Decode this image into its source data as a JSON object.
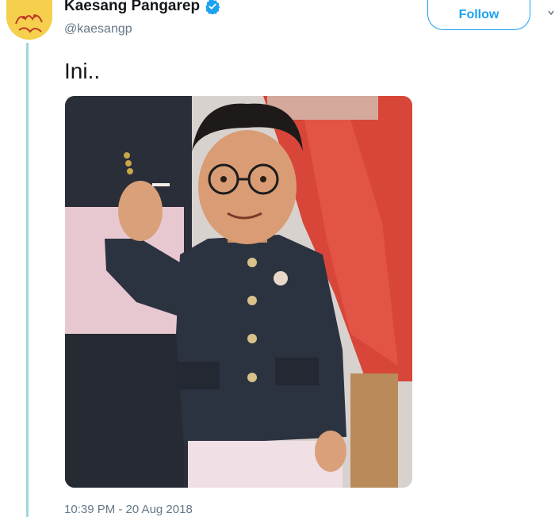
{
  "tweet": {
    "author_name": "Kaesang Pangarep",
    "author_handle": "@kaesangp",
    "verified": true,
    "follow_label": "Follow",
    "text": "Ini..",
    "timestamp": "10:39 PM - 20 Aug 2018"
  },
  "icons": {
    "verified": "verified-badge-icon",
    "avatar": "avatar-illustration",
    "media": "photo-man-in-dark-jacket"
  },
  "colors": {
    "accent": "#1da1f2",
    "thread_line": "#9fd7dc",
    "secondary_text": "#657786",
    "avatar_bg": "#f6d04d"
  }
}
